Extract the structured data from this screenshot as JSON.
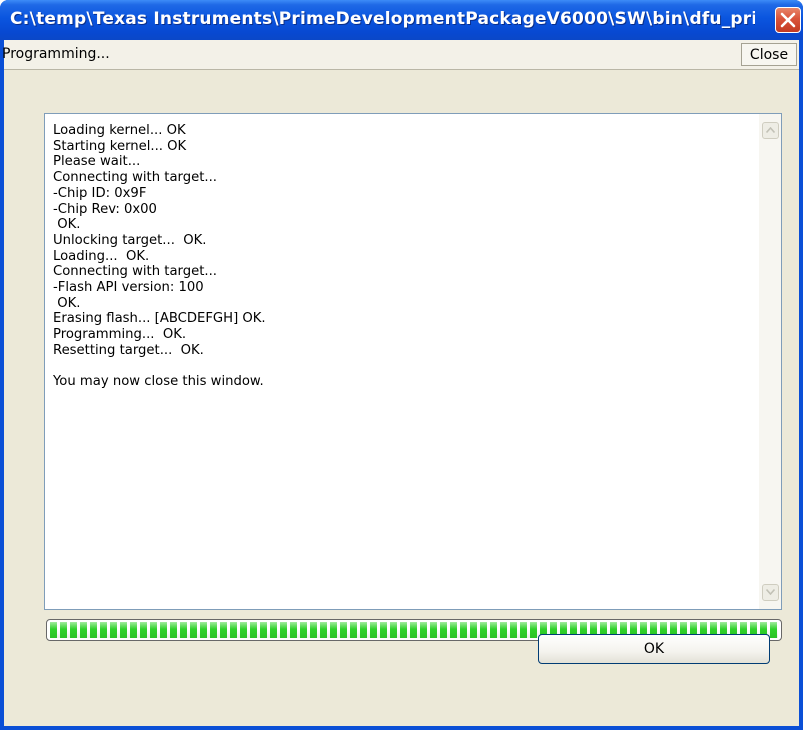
{
  "window": {
    "title": "C:\\temp\\Texas Instruments\\PrimeDevelopmentPackageV6000\\SW\\bin\\dfu_pri...",
    "close_icon": "close-x-icon"
  },
  "toolbar": {
    "status": "Programming...",
    "close_label": "Close"
  },
  "log": {
    "lines": [
      "Loading kernel... OK",
      "Starting kernel... OK",
      "Please wait...",
      "Connecting with target...",
      "-Chip ID: 0x9F",
      "-Chip Rev: 0x00",
      " OK.",
      "Unlocking target...  OK.",
      "Loading...  OK.",
      "Connecting with target...",
      "-Flash API version: 100",
      " OK.",
      "Erasing flash... [ABCDEFGH] OK.",
      "Programming...  OK.",
      "Resetting target...  OK.",
      "",
      "You may now close this window."
    ]
  },
  "progress": {
    "value": 1.0
  },
  "dialog": {
    "ok_label": "OK"
  },
  "colors": {
    "titlebar": "#0a55df",
    "progress_fill": "#2fd22a",
    "client_bg": "#ece9d8"
  }
}
